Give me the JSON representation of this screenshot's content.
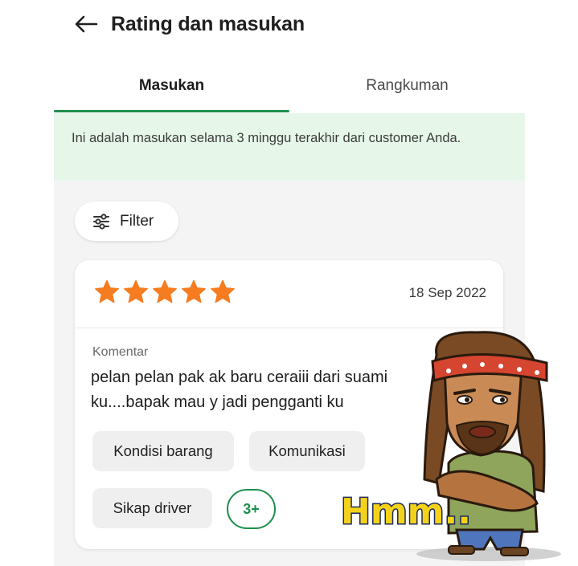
{
  "header": {
    "title": "Rating dan masukan",
    "back_icon": "arrow-left-icon"
  },
  "tabs": [
    {
      "label": "Masukan",
      "active": true
    },
    {
      "label": "Rangkuman",
      "active": false
    }
  ],
  "banner": {
    "text": "Ini adalah masukan selama 3 minggu terakhir dari customer Anda."
  },
  "filter": {
    "label": "Filter",
    "icon": "sliders-icon"
  },
  "review": {
    "rating": 5,
    "max_rating": 5,
    "date": "18 Sep 2022",
    "comment_label": "Komentar",
    "comment_text": "pelan pelan pak ak baru ceraiii dari suami ku....bapak mau y jadi pengganti ku",
    "tags": [
      "Kondisi barang",
      "Komunikasi",
      "Sikap driver"
    ],
    "more_tags": "3+"
  },
  "sticker": {
    "text": "Hmm.."
  },
  "colors": {
    "accent_green": "#1e8f4d",
    "banner_bg": "#e6f6e9",
    "star_orange": "#f57c1f",
    "content_bg": "#f4f4f5"
  }
}
